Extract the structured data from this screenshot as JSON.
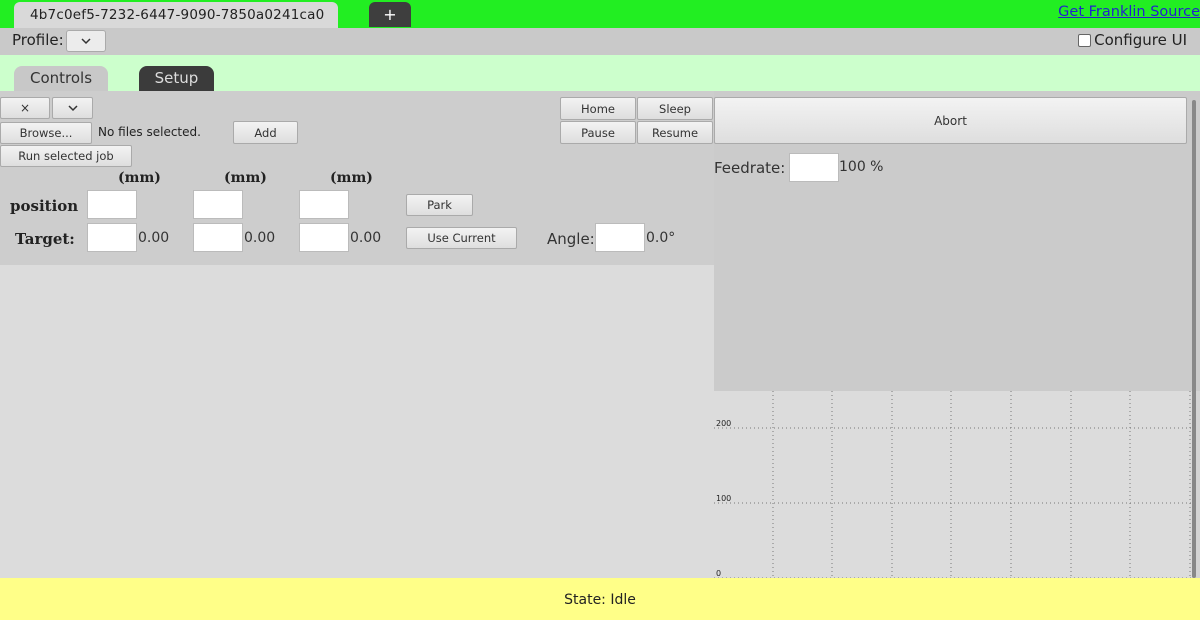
{
  "tabs": {
    "machine_id": "4b7c0ef5-7232-6447-9090-7850a0241ca0",
    "add_label": "+"
  },
  "header": {
    "source_link": "Get Franklin Source",
    "profile_label": "Profile:",
    "profile_select_icon": "chevron-down",
    "configure_label": "Configure UI",
    "configure_checked": false
  },
  "panel_tabs": [
    "Controls",
    "Setup"
  ],
  "jobs": {
    "remove_label": "×",
    "menu_icon": "chevron-down",
    "browse_label": "Browse...",
    "file_status": "No files selected.",
    "add_label": "Add",
    "run_label": "Run selected job"
  },
  "machine_buttons": {
    "home": "Home",
    "sleep": "Sleep",
    "pause": "Pause",
    "resume": "Resume",
    "abort": "Abort"
  },
  "position": {
    "unit": "(mm)",
    "position_label": "position",
    "target_label": "Target:",
    "target_values": [
      "0.00",
      "0.00",
      "0.00"
    ],
    "park_label": "Park",
    "use_current_label": "Use Current",
    "angle_label": "Angle:",
    "angle_value": "0.0°"
  },
  "feedrate": {
    "label": "Feedrate:",
    "value": "100 %"
  },
  "graph": {
    "y_ticks": [
      "200",
      "100",
      "0"
    ]
  },
  "status": {
    "text": "State: Idle"
  },
  "colors": {
    "top_bar": "#22ee22",
    "tab_strip": "#ccffcc",
    "status_bar": "#ffff88"
  }
}
